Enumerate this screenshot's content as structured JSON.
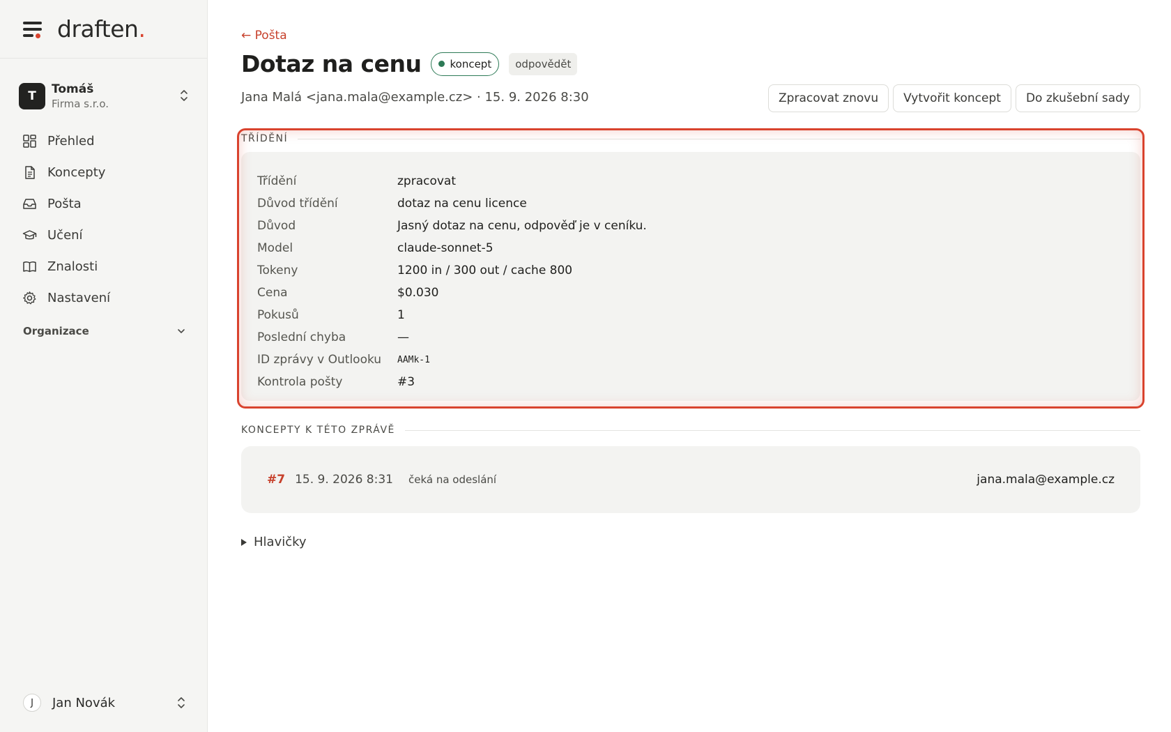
{
  "app": {
    "brand": "draften",
    "brand_dot": "."
  },
  "sidebar": {
    "org": {
      "avatar_letter": "T",
      "user": "Tomáš",
      "company": "Firma s.r.o."
    },
    "items": [
      {
        "label": "Přehled",
        "icon": "dashboard-icon"
      },
      {
        "label": "Koncepty",
        "icon": "document-icon"
      },
      {
        "label": "Pošta",
        "icon": "inbox-icon"
      },
      {
        "label": "Učení",
        "icon": "graduation-cap-icon"
      },
      {
        "label": "Znalosti",
        "icon": "book-icon"
      },
      {
        "label": "Nastavení",
        "icon": "gear-icon"
      }
    ],
    "section_label": "Organizace",
    "user": {
      "avatar_letter": "J",
      "name": "Jan Novák"
    }
  },
  "header": {
    "back_link": "← Pošta",
    "title": "Dotaz na cenu",
    "badge_status": "koncept",
    "badge_type": "odpovědět",
    "meta": "Jana Malá <jana.mala@example.cz> · 15. 9. 2026 8:30",
    "actions": {
      "reprocess": "Zpracovat znovu",
      "create_draft": "Vytvořit koncept",
      "add_to_test_set": "Do zkušební sady"
    }
  },
  "triage": {
    "heading": "TŘÍDĚNÍ",
    "rows": [
      {
        "key": "Třídění",
        "value": "zpracovat"
      },
      {
        "key": "Důvod třídění",
        "value": "dotaz na cenu licence"
      },
      {
        "key": "Důvod",
        "value": "Jasný dotaz na cenu, odpověď je v ceníku."
      },
      {
        "key": "Model",
        "value": "claude-sonnet-5"
      },
      {
        "key": "Tokeny",
        "value": "1200 in / 300 out / cache 800"
      },
      {
        "key": "Cena",
        "value": "$0.030"
      },
      {
        "key": "Pokusů",
        "value": "1"
      },
      {
        "key": "Poslední chyba",
        "value": "—"
      },
      {
        "key": "ID zprávy v Outlooku",
        "value": "AAMk-1"
      },
      {
        "key": "Kontrola pošty",
        "value": "#3"
      }
    ]
  },
  "drafts": {
    "heading": "KONCEPTY K TÉTO ZPRÁVĚ",
    "items": [
      {
        "id": "#7",
        "date": "15. 9. 2026 8:31",
        "status": "čeká na odeslání",
        "to": "jana.mala@example.cz"
      }
    ]
  },
  "headers_toggle": "Hlavičky",
  "colors": {
    "accent": "#d9432e",
    "link": "#c7412c",
    "success": "#2d7a56",
    "sidebar_bg": "#f5f5f3"
  }
}
